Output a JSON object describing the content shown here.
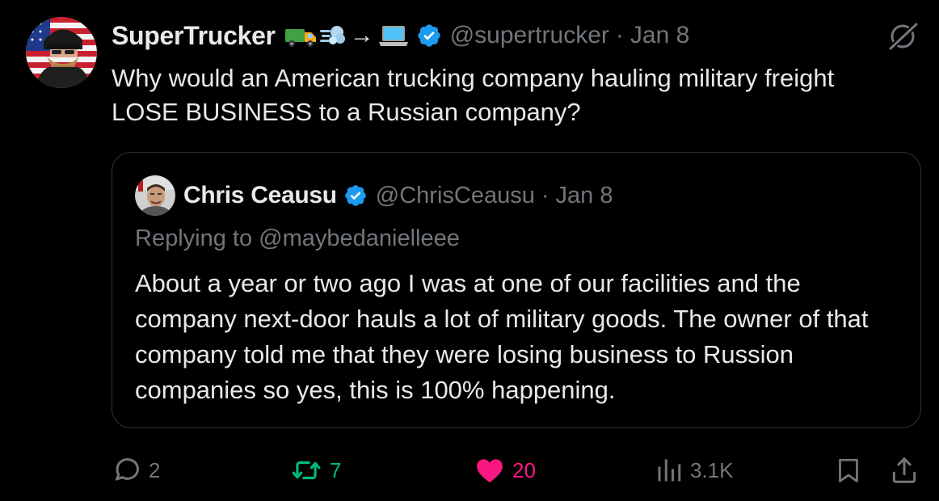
{
  "tweet": {
    "display_name": "SuperTrucker",
    "name_emojis": [
      "truck-emoji",
      "dash-emoji",
      "arrow-emoji",
      "laptop-emoji"
    ],
    "arrow_glyph": "→",
    "handle": "@supertrucker",
    "separator": "·",
    "date": "Jan 8",
    "text": "Why would an American trucking company hauling military freight LOSE BUSINESS to a Russian company?"
  },
  "quote": {
    "display_name": "Chris Ceausu",
    "handle": "@ChrisCeausu",
    "separator": "·",
    "date": "Jan 8",
    "reply_to": "Replying to @maybedanielleee",
    "text": "About a year or two ago I was at one of our facilities and the company next-door hauls a lot of military goods. The owner of that company told me that they were losing business to Russion companies so yes, this is 100% happening."
  },
  "actions": {
    "replies": "2",
    "reposts": "7",
    "likes": "20",
    "views": "3.1K"
  },
  "colors": {
    "background": "#000000",
    "text": "#e7e9ea",
    "secondary": "#71767b",
    "verified": "#1d9bf0",
    "repost": "#00ba7c",
    "like": "#f91880",
    "border": "#2f3336"
  }
}
